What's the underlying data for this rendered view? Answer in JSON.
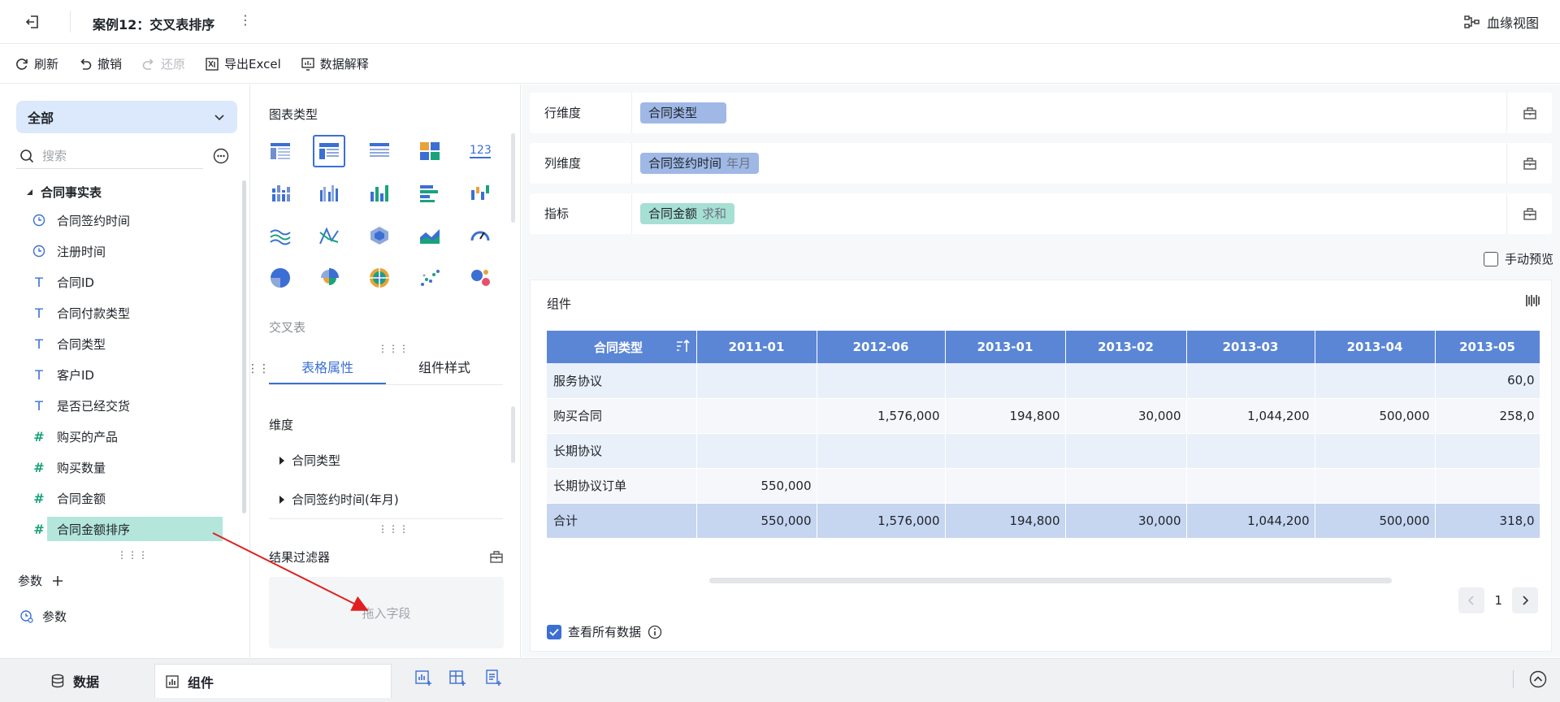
{
  "topbar": {
    "title": "案例12：交叉表排序",
    "more_label": "⋮",
    "lineage_label": "血缘视图"
  },
  "toolbar": {
    "refresh": "刷新",
    "undo": "撤销",
    "redo": "还原",
    "export": "导出Excel",
    "explain": "数据解释"
  },
  "left": {
    "scope": "全部",
    "search_placeholder": "搜索",
    "table_name": "合同事实表",
    "fields": [
      {
        "label": "合同签约时间",
        "icon": "clock-icon"
      },
      {
        "label": "注册时间",
        "icon": "clock-icon"
      },
      {
        "label": "合同ID",
        "icon": "text-type-icon"
      },
      {
        "label": "合同付款类型",
        "icon": "text-type-icon"
      },
      {
        "label": "合同类型",
        "icon": "text-type-icon"
      },
      {
        "label": "客户ID",
        "icon": "text-type-icon"
      },
      {
        "label": "是否已经交货",
        "icon": "text-type-icon"
      },
      {
        "label": "购买的产品",
        "icon": "number-type-icon"
      },
      {
        "label": "购买数量",
        "icon": "number-type-icon"
      },
      {
        "label": "合同金额",
        "icon": "number-type-icon"
      },
      {
        "label": "合同金额排序",
        "icon": "number-type-icon"
      }
    ],
    "params_head": "参数",
    "params_item": "参数"
  },
  "mid": {
    "chart_type_title": "图表类型",
    "cross_table_label": "交叉表",
    "tabs": [
      "表格属性",
      "组件样式"
    ],
    "dimension_title": "维度",
    "dimensions": [
      "合同类型",
      "合同签约时间(年月)"
    ],
    "filter_title": "结果过滤器",
    "drop_hint": "拖入字段"
  },
  "right": {
    "row_dim_label": "行维度",
    "row_dim_value": "合同类型",
    "col_dim_label": "列维度",
    "col_dim_value": "合同签约时间",
    "col_dim_sub": "年月",
    "metric_label": "指标",
    "metric_value": "合同金额",
    "metric_sub": "求和",
    "manual_preview": "手动预览",
    "component_title": "组件",
    "table": {
      "headers": [
        "合同类型",
        "2011-01",
        "2012-06",
        "2013-01",
        "2013-02",
        "2013-03",
        "2013-04",
        "2013-05"
      ],
      "rows": [
        [
          "服务协议",
          "",
          "",
          "",
          "",
          "",
          "",
          "60,0"
        ],
        [
          "购买合同",
          "",
          "1,576,000",
          "194,800",
          "30,000",
          "1,044,200",
          "500,000",
          "258,0"
        ],
        [
          "长期协议",
          "",
          "",
          "",
          "",
          "",
          "",
          ""
        ],
        [
          "长期协议订单",
          "550,000",
          "",
          "",
          "",
          "",
          "",
          ""
        ],
        [
          "合计",
          "550,000",
          "1,576,000",
          "194,800",
          "30,000",
          "1,044,200",
          "500,000",
          "318,0"
        ]
      ]
    },
    "page_number": "1",
    "view_all": "查看所有数据"
  },
  "bottom": {
    "data_tab": "数据",
    "component_tab": "组件"
  },
  "colors": {
    "accent": "#3b6fd4",
    "header_bg": "#5b86d6",
    "highlight_field": "#b4e6dc",
    "dim_pill": "#9fb8e6",
    "metric_pill": "#a6dfd3",
    "arrow": "#e02020"
  }
}
